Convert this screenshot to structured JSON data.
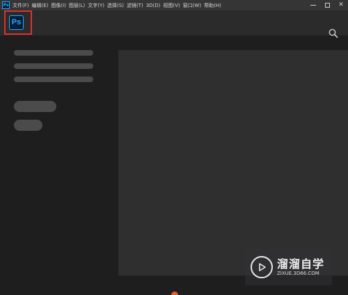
{
  "app": {
    "icon_label": "Ps"
  },
  "menu": [
    {
      "label": "文件(F)"
    },
    {
      "label": "编辑(E)"
    },
    {
      "label": "图像(I)"
    },
    {
      "label": "图层(L)"
    },
    {
      "label": "文字(Y)"
    },
    {
      "label": "选择(S)"
    },
    {
      "label": "滤镜(T)"
    },
    {
      "label": "3D(D)"
    },
    {
      "label": "视图(V)"
    },
    {
      "label": "窗口(W)"
    },
    {
      "label": "帮助(H)"
    }
  ],
  "window_controls": {
    "close_glyph": "✕"
  },
  "home": {
    "logo_text": "Ps",
    "search_icon": "search-icon"
  },
  "colors": {
    "accent": "#31a8ff",
    "highlight_box": "#e03030",
    "background": "#1e1e1e",
    "topbar": "#2b2b2b",
    "placeholder": "#4b4b4b",
    "panel": "#2f2f2f"
  },
  "watermark": {
    "title": "溜溜自学",
    "url": "ZIXUE.3D66.COM"
  }
}
